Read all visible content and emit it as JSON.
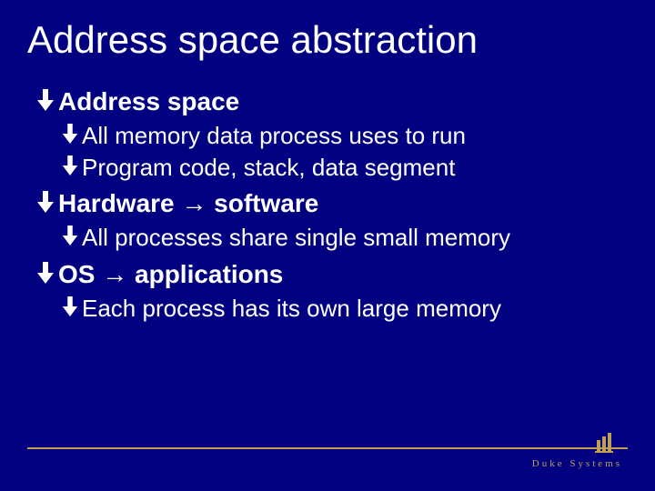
{
  "title": "Address space abstraction",
  "bullets": {
    "b1": {
      "text": "Address space"
    },
    "b1a": {
      "text": "All memory data process uses to run"
    },
    "b1b": {
      "text": "Program code, stack, data segment"
    },
    "b2": {
      "pre": "Hardware ",
      "post": " software"
    },
    "b2a": {
      "text": "All processes share single small memory"
    },
    "b3": {
      "pre": "OS ",
      "post": " applications"
    },
    "b3a": {
      "text": "Each process has its own large memory"
    }
  },
  "footer": {
    "brand": "Duke Systems"
  },
  "icons": {
    "bullet": "down-arrow-icon",
    "inline": "right-arrow-icon"
  },
  "colors": {
    "bg": "#000080",
    "accent": "#c0a050",
    "text": "#ffffff"
  }
}
